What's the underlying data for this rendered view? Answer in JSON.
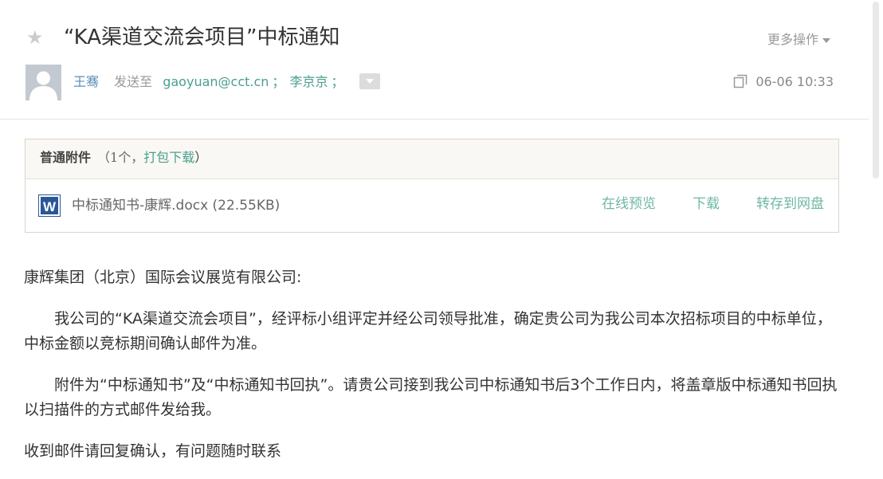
{
  "header": {
    "subject": "“KA渠道交流会项目”中标通知",
    "more_actions_label": "更多操作",
    "sender_name": "王骞",
    "sent_to_label": "发送至",
    "recipients": [
      "gaoyuan@cct.cn",
      "李京京"
    ],
    "recipient_separator": "；",
    "time": "06-06 10:33"
  },
  "icons": {
    "star": "star-icon",
    "avatar": "avatar-placeholder",
    "expand": "chevron-down-icon",
    "copy": "copy-window-icon",
    "word": "word-document-icon"
  },
  "attachments": {
    "title": "普通附件",
    "count_open": "（1个，",
    "pack_download_label": "打包下载",
    "count_close": "）",
    "files": [
      {
        "name": "中标通知书-康辉.docx",
        "size": "(22.55KB)",
        "preview_label": "在线预览",
        "download_label": "下载",
        "save_to_disk_label": "转存到网盘"
      }
    ]
  },
  "body": {
    "greeting": "康辉集团（北京）国际会议展览有限公司:",
    "paragraph_1": "我公司的“KA渠道交流会项目”，经评标小组评定并经公司领导批准，确定贵公司为我公司本次招标项目的中标单位，中标金额以竞标期间确认邮件为准。",
    "paragraph_2": "附件为“中标通知书”及“中标通知书回执”。请贵公司接到我公司中标通知书后3个工作日内，将盖章版中标通知书回执以扫描件的方式邮件发给我。",
    "closing": "收到邮件请回复确认，有问题随时联系"
  },
  "colors": {
    "accent_link": "#4a9e8f",
    "sender_name": "#5b8fb9",
    "muted_text": "#999999",
    "attachment_border": "#dcd5c8",
    "word_blue": "#2b5797"
  }
}
